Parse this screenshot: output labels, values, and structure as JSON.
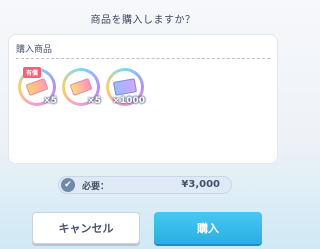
{
  "dialog": {
    "title": "商品を購入しますか？"
  },
  "panel": {
    "label": "購入商品"
  },
  "items": [
    {
      "icon": "ticket-icon",
      "quantity": "×5",
      "badge": "有償"
    },
    {
      "icon": "ticket-icon",
      "quantity": "×5"
    },
    {
      "icon": "gem-ticket-icon",
      "quantity": "×1000"
    }
  ],
  "cost": {
    "label": "必要：",
    "value": "¥3,000"
  },
  "buttons": {
    "cancel_label": "キャンセル",
    "buy_label": "購入"
  }
}
